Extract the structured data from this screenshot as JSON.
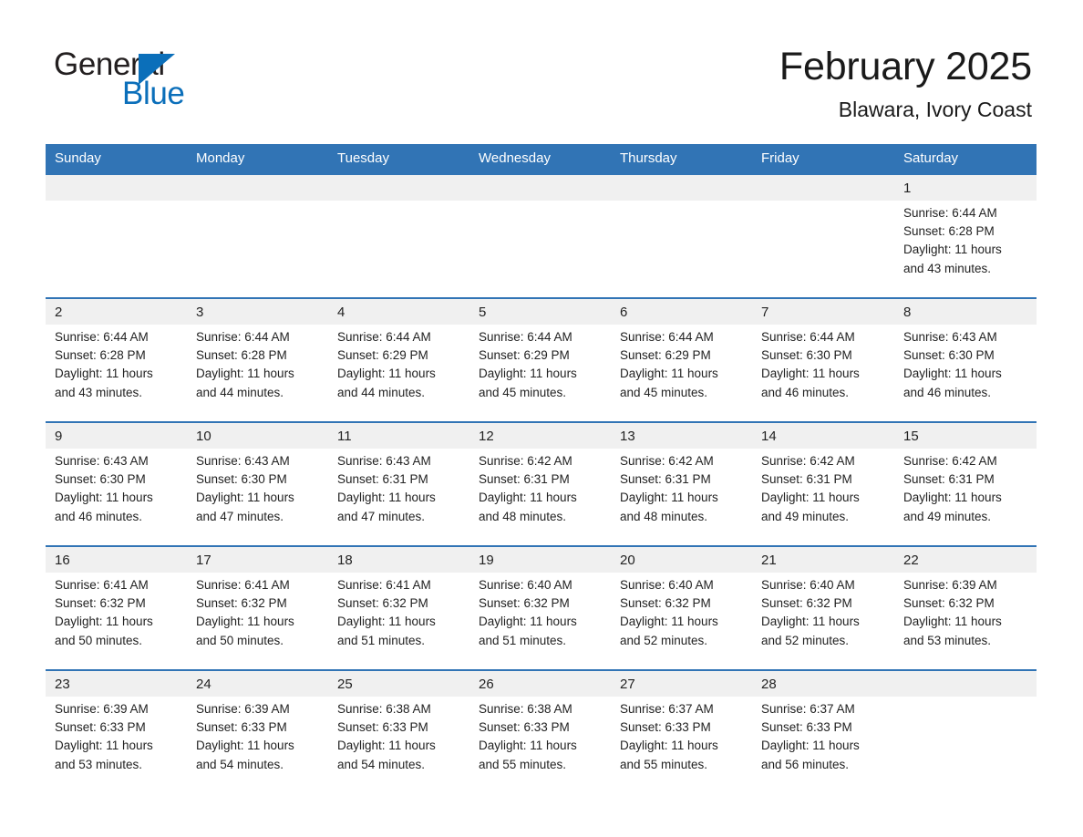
{
  "brand": {
    "name_part1": "General",
    "name_part2": "Blue",
    "logo_icon": "triangle-mark",
    "color_primary": "#0b6fba",
    "color_text": "#231f20"
  },
  "header": {
    "title": "February 2025",
    "location": "Blawara, Ivory Coast",
    "accent_color": "#3174b5",
    "daynum_band_color": "#f0f0f0"
  },
  "calendar": {
    "weekday_headers": [
      "Sunday",
      "Monday",
      "Tuesday",
      "Wednesday",
      "Thursday",
      "Friday",
      "Saturday"
    ],
    "weeks": [
      {
        "days": [
          {
            "num": "",
            "sunrise": "",
            "sunset": "",
            "daylight_l1": "",
            "daylight_l2": ""
          },
          {
            "num": "",
            "sunrise": "",
            "sunset": "",
            "daylight_l1": "",
            "daylight_l2": ""
          },
          {
            "num": "",
            "sunrise": "",
            "sunset": "",
            "daylight_l1": "",
            "daylight_l2": ""
          },
          {
            "num": "",
            "sunrise": "",
            "sunset": "",
            "daylight_l1": "",
            "daylight_l2": ""
          },
          {
            "num": "",
            "sunrise": "",
            "sunset": "",
            "daylight_l1": "",
            "daylight_l2": ""
          },
          {
            "num": "",
            "sunrise": "",
            "sunset": "",
            "daylight_l1": "",
            "daylight_l2": ""
          },
          {
            "num": "1",
            "sunrise": "Sunrise: 6:44 AM",
            "sunset": "Sunset: 6:28 PM",
            "daylight_l1": "Daylight: 11 hours",
            "daylight_l2": "and 43 minutes."
          }
        ]
      },
      {
        "days": [
          {
            "num": "2",
            "sunrise": "Sunrise: 6:44 AM",
            "sunset": "Sunset: 6:28 PM",
            "daylight_l1": "Daylight: 11 hours",
            "daylight_l2": "and 43 minutes."
          },
          {
            "num": "3",
            "sunrise": "Sunrise: 6:44 AM",
            "sunset": "Sunset: 6:28 PM",
            "daylight_l1": "Daylight: 11 hours",
            "daylight_l2": "and 44 minutes."
          },
          {
            "num": "4",
            "sunrise": "Sunrise: 6:44 AM",
            "sunset": "Sunset: 6:29 PM",
            "daylight_l1": "Daylight: 11 hours",
            "daylight_l2": "and 44 minutes."
          },
          {
            "num": "5",
            "sunrise": "Sunrise: 6:44 AM",
            "sunset": "Sunset: 6:29 PM",
            "daylight_l1": "Daylight: 11 hours",
            "daylight_l2": "and 45 minutes."
          },
          {
            "num": "6",
            "sunrise": "Sunrise: 6:44 AM",
            "sunset": "Sunset: 6:29 PM",
            "daylight_l1": "Daylight: 11 hours",
            "daylight_l2": "and 45 minutes."
          },
          {
            "num": "7",
            "sunrise": "Sunrise: 6:44 AM",
            "sunset": "Sunset: 6:30 PM",
            "daylight_l1": "Daylight: 11 hours",
            "daylight_l2": "and 46 minutes."
          },
          {
            "num": "8",
            "sunrise": "Sunrise: 6:43 AM",
            "sunset": "Sunset: 6:30 PM",
            "daylight_l1": "Daylight: 11 hours",
            "daylight_l2": "and 46 minutes."
          }
        ]
      },
      {
        "days": [
          {
            "num": "9",
            "sunrise": "Sunrise: 6:43 AM",
            "sunset": "Sunset: 6:30 PM",
            "daylight_l1": "Daylight: 11 hours",
            "daylight_l2": "and 46 minutes."
          },
          {
            "num": "10",
            "sunrise": "Sunrise: 6:43 AM",
            "sunset": "Sunset: 6:30 PM",
            "daylight_l1": "Daylight: 11 hours",
            "daylight_l2": "and 47 minutes."
          },
          {
            "num": "11",
            "sunrise": "Sunrise: 6:43 AM",
            "sunset": "Sunset: 6:31 PM",
            "daylight_l1": "Daylight: 11 hours",
            "daylight_l2": "and 47 minutes."
          },
          {
            "num": "12",
            "sunrise": "Sunrise: 6:42 AM",
            "sunset": "Sunset: 6:31 PM",
            "daylight_l1": "Daylight: 11 hours",
            "daylight_l2": "and 48 minutes."
          },
          {
            "num": "13",
            "sunrise": "Sunrise: 6:42 AM",
            "sunset": "Sunset: 6:31 PM",
            "daylight_l1": "Daylight: 11 hours",
            "daylight_l2": "and 48 minutes."
          },
          {
            "num": "14",
            "sunrise": "Sunrise: 6:42 AM",
            "sunset": "Sunset: 6:31 PM",
            "daylight_l1": "Daylight: 11 hours",
            "daylight_l2": "and 49 minutes."
          },
          {
            "num": "15",
            "sunrise": "Sunrise: 6:42 AM",
            "sunset": "Sunset: 6:31 PM",
            "daylight_l1": "Daylight: 11 hours",
            "daylight_l2": "and 49 minutes."
          }
        ]
      },
      {
        "days": [
          {
            "num": "16",
            "sunrise": "Sunrise: 6:41 AM",
            "sunset": "Sunset: 6:32 PM",
            "daylight_l1": "Daylight: 11 hours",
            "daylight_l2": "and 50 minutes."
          },
          {
            "num": "17",
            "sunrise": "Sunrise: 6:41 AM",
            "sunset": "Sunset: 6:32 PM",
            "daylight_l1": "Daylight: 11 hours",
            "daylight_l2": "and 50 minutes."
          },
          {
            "num": "18",
            "sunrise": "Sunrise: 6:41 AM",
            "sunset": "Sunset: 6:32 PM",
            "daylight_l1": "Daylight: 11 hours",
            "daylight_l2": "and 51 minutes."
          },
          {
            "num": "19",
            "sunrise": "Sunrise: 6:40 AM",
            "sunset": "Sunset: 6:32 PM",
            "daylight_l1": "Daylight: 11 hours",
            "daylight_l2": "and 51 minutes."
          },
          {
            "num": "20",
            "sunrise": "Sunrise: 6:40 AM",
            "sunset": "Sunset: 6:32 PM",
            "daylight_l1": "Daylight: 11 hours",
            "daylight_l2": "and 52 minutes."
          },
          {
            "num": "21",
            "sunrise": "Sunrise: 6:40 AM",
            "sunset": "Sunset: 6:32 PM",
            "daylight_l1": "Daylight: 11 hours",
            "daylight_l2": "and 52 minutes."
          },
          {
            "num": "22",
            "sunrise": "Sunrise: 6:39 AM",
            "sunset": "Sunset: 6:32 PM",
            "daylight_l1": "Daylight: 11 hours",
            "daylight_l2": "and 53 minutes."
          }
        ]
      },
      {
        "days": [
          {
            "num": "23",
            "sunrise": "Sunrise: 6:39 AM",
            "sunset": "Sunset: 6:33 PM",
            "daylight_l1": "Daylight: 11 hours",
            "daylight_l2": "and 53 minutes."
          },
          {
            "num": "24",
            "sunrise": "Sunrise: 6:39 AM",
            "sunset": "Sunset: 6:33 PM",
            "daylight_l1": "Daylight: 11 hours",
            "daylight_l2": "and 54 minutes."
          },
          {
            "num": "25",
            "sunrise": "Sunrise: 6:38 AM",
            "sunset": "Sunset: 6:33 PM",
            "daylight_l1": "Daylight: 11 hours",
            "daylight_l2": "and 54 minutes."
          },
          {
            "num": "26",
            "sunrise": "Sunrise: 6:38 AM",
            "sunset": "Sunset: 6:33 PM",
            "daylight_l1": "Daylight: 11 hours",
            "daylight_l2": "and 55 minutes."
          },
          {
            "num": "27",
            "sunrise": "Sunrise: 6:37 AM",
            "sunset": "Sunset: 6:33 PM",
            "daylight_l1": "Daylight: 11 hours",
            "daylight_l2": "and 55 minutes."
          },
          {
            "num": "28",
            "sunrise": "Sunrise: 6:37 AM",
            "sunset": "Sunset: 6:33 PM",
            "daylight_l1": "Daylight: 11 hours",
            "daylight_l2": "and 56 minutes."
          },
          {
            "num": "",
            "sunrise": "",
            "sunset": "",
            "daylight_l1": "",
            "daylight_l2": ""
          }
        ]
      }
    ]
  }
}
